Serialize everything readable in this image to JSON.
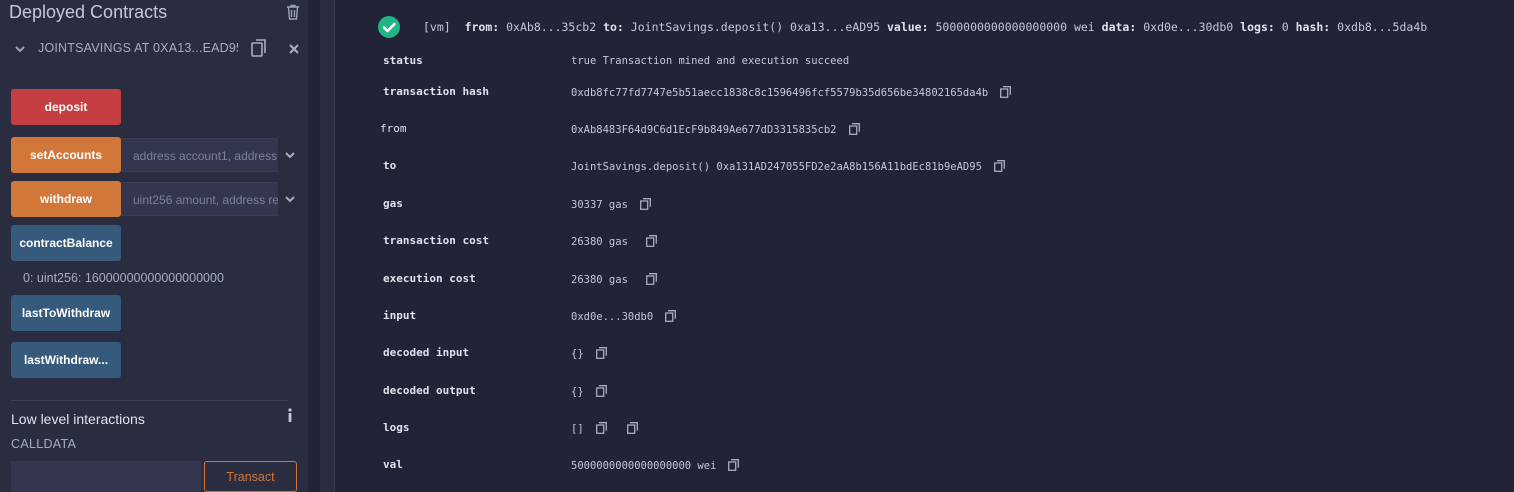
{
  "left_panel": {
    "title": "Deployed Contracts",
    "contract_name": "JOINTSAVINGS AT 0XA13...EAD95 (",
    "functions": [
      {
        "label": "deposit",
        "color": "#c53f42"
      },
      {
        "label": "setAccounts",
        "color": "#d2773a",
        "placeholder": "address account1, address"
      },
      {
        "label": "withdraw",
        "color": "#d2773a",
        "placeholder": "uint256 amount, address re"
      },
      {
        "label": "contractBalance",
        "color": "#355a7c"
      },
      {
        "label": "lastToWithdraw",
        "color": "#355a7c"
      },
      {
        "label": "lastWithdraw...",
        "color": "#355a7c"
      }
    ],
    "contract_balance_output": "0: uint256: 16000000000000000000",
    "low_level_title": "Low level interactions",
    "calldata_label": "CALLDATA",
    "transact_label": "Transact"
  },
  "tx": {
    "tag": "[vm]",
    "from_key": "from:",
    "from_val": "0xAb8...35cb2",
    "to_key": "to:",
    "to_val": "JointSavings.deposit() 0xa13...eAD95",
    "value_key": "value:",
    "value_val": "5000000000000000000 wei",
    "data_key": "data:",
    "data_val": "0xd0e...30db0",
    "logs_key": "logs:",
    "logs_val": "0",
    "hash_key": "hash:",
    "hash_val": "0xdb8...5da4b",
    "rows": [
      {
        "label": "status",
        "value": "true Transaction mined and execution succeed"
      },
      {
        "label": "transaction hash",
        "value": "0xdb8fc77fd7747e5b51aecc1838c8c1596496fcf5579b35d656be34802165da4b"
      },
      {
        "label": "from",
        "value": "0xAb8483F64d9C6d1EcF9b849Ae677dD3315835cb2"
      },
      {
        "label": "to",
        "value": "JointSavings.deposit() 0xa131AD247055FD2e2aA8b156A11bdEc81b9eAD95"
      },
      {
        "label": "gas",
        "value": "30337 gas"
      },
      {
        "label": "transaction cost",
        "value": "26380 gas"
      },
      {
        "label": "execution cost",
        "value": "26380 gas"
      },
      {
        "label": "input",
        "value": "0xd0e...30db0"
      },
      {
        "label": "decoded input",
        "value": "{}"
      },
      {
        "label": "decoded output",
        "value": "{}"
      },
      {
        "label": "logs",
        "value": "[]"
      },
      {
        "label": "val",
        "value": "5000000000000000000 wei"
      }
    ]
  },
  "colors": {
    "success": "#20b486",
    "deposit": "#c53f42",
    "transact_fn": "#d2773a",
    "call_fn": "#355a7c"
  }
}
